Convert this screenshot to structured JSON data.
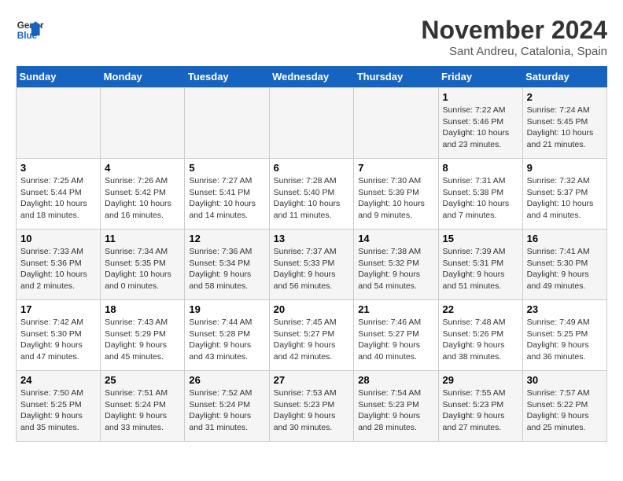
{
  "logo": {
    "line1": "General",
    "line2": "Blue"
  },
  "title": "November 2024",
  "subtitle": "Sant Andreu, Catalonia, Spain",
  "days_header": [
    "Sunday",
    "Monday",
    "Tuesday",
    "Wednesday",
    "Thursday",
    "Friday",
    "Saturday"
  ],
  "weeks": [
    [
      {
        "day": "",
        "info": ""
      },
      {
        "day": "",
        "info": ""
      },
      {
        "day": "",
        "info": ""
      },
      {
        "day": "",
        "info": ""
      },
      {
        "day": "",
        "info": ""
      },
      {
        "day": "1",
        "info": "Sunrise: 7:22 AM\nSunset: 5:46 PM\nDaylight: 10 hours and 23 minutes."
      },
      {
        "day": "2",
        "info": "Sunrise: 7:24 AM\nSunset: 5:45 PM\nDaylight: 10 hours and 21 minutes."
      }
    ],
    [
      {
        "day": "3",
        "info": "Sunrise: 7:25 AM\nSunset: 5:44 PM\nDaylight: 10 hours and 18 minutes."
      },
      {
        "day": "4",
        "info": "Sunrise: 7:26 AM\nSunset: 5:42 PM\nDaylight: 10 hours and 16 minutes."
      },
      {
        "day": "5",
        "info": "Sunrise: 7:27 AM\nSunset: 5:41 PM\nDaylight: 10 hours and 14 minutes."
      },
      {
        "day": "6",
        "info": "Sunrise: 7:28 AM\nSunset: 5:40 PM\nDaylight: 10 hours and 11 minutes."
      },
      {
        "day": "7",
        "info": "Sunrise: 7:30 AM\nSunset: 5:39 PM\nDaylight: 10 hours and 9 minutes."
      },
      {
        "day": "8",
        "info": "Sunrise: 7:31 AM\nSunset: 5:38 PM\nDaylight: 10 hours and 7 minutes."
      },
      {
        "day": "9",
        "info": "Sunrise: 7:32 AM\nSunset: 5:37 PM\nDaylight: 10 hours and 4 minutes."
      }
    ],
    [
      {
        "day": "10",
        "info": "Sunrise: 7:33 AM\nSunset: 5:36 PM\nDaylight: 10 hours and 2 minutes."
      },
      {
        "day": "11",
        "info": "Sunrise: 7:34 AM\nSunset: 5:35 PM\nDaylight: 10 hours and 0 minutes."
      },
      {
        "day": "12",
        "info": "Sunrise: 7:36 AM\nSunset: 5:34 PM\nDaylight: 9 hours and 58 minutes."
      },
      {
        "day": "13",
        "info": "Sunrise: 7:37 AM\nSunset: 5:33 PM\nDaylight: 9 hours and 56 minutes."
      },
      {
        "day": "14",
        "info": "Sunrise: 7:38 AM\nSunset: 5:32 PM\nDaylight: 9 hours and 54 minutes."
      },
      {
        "day": "15",
        "info": "Sunrise: 7:39 AM\nSunset: 5:31 PM\nDaylight: 9 hours and 51 minutes."
      },
      {
        "day": "16",
        "info": "Sunrise: 7:41 AM\nSunset: 5:30 PM\nDaylight: 9 hours and 49 minutes."
      }
    ],
    [
      {
        "day": "17",
        "info": "Sunrise: 7:42 AM\nSunset: 5:30 PM\nDaylight: 9 hours and 47 minutes."
      },
      {
        "day": "18",
        "info": "Sunrise: 7:43 AM\nSunset: 5:29 PM\nDaylight: 9 hours and 45 minutes."
      },
      {
        "day": "19",
        "info": "Sunrise: 7:44 AM\nSunset: 5:28 PM\nDaylight: 9 hours and 43 minutes."
      },
      {
        "day": "20",
        "info": "Sunrise: 7:45 AM\nSunset: 5:27 PM\nDaylight: 9 hours and 42 minutes."
      },
      {
        "day": "21",
        "info": "Sunrise: 7:46 AM\nSunset: 5:27 PM\nDaylight: 9 hours and 40 minutes."
      },
      {
        "day": "22",
        "info": "Sunrise: 7:48 AM\nSunset: 5:26 PM\nDaylight: 9 hours and 38 minutes."
      },
      {
        "day": "23",
        "info": "Sunrise: 7:49 AM\nSunset: 5:25 PM\nDaylight: 9 hours and 36 minutes."
      }
    ],
    [
      {
        "day": "24",
        "info": "Sunrise: 7:50 AM\nSunset: 5:25 PM\nDaylight: 9 hours and 35 minutes."
      },
      {
        "day": "25",
        "info": "Sunrise: 7:51 AM\nSunset: 5:24 PM\nDaylight: 9 hours and 33 minutes."
      },
      {
        "day": "26",
        "info": "Sunrise: 7:52 AM\nSunset: 5:24 PM\nDaylight: 9 hours and 31 minutes."
      },
      {
        "day": "27",
        "info": "Sunrise: 7:53 AM\nSunset: 5:23 PM\nDaylight: 9 hours and 30 minutes."
      },
      {
        "day": "28",
        "info": "Sunrise: 7:54 AM\nSunset: 5:23 PM\nDaylight: 9 hours and 28 minutes."
      },
      {
        "day": "29",
        "info": "Sunrise: 7:55 AM\nSunset: 5:23 PM\nDaylight: 9 hours and 27 minutes."
      },
      {
        "day": "30",
        "info": "Sunrise: 7:57 AM\nSunset: 5:22 PM\nDaylight: 9 hours and 25 minutes."
      }
    ]
  ]
}
